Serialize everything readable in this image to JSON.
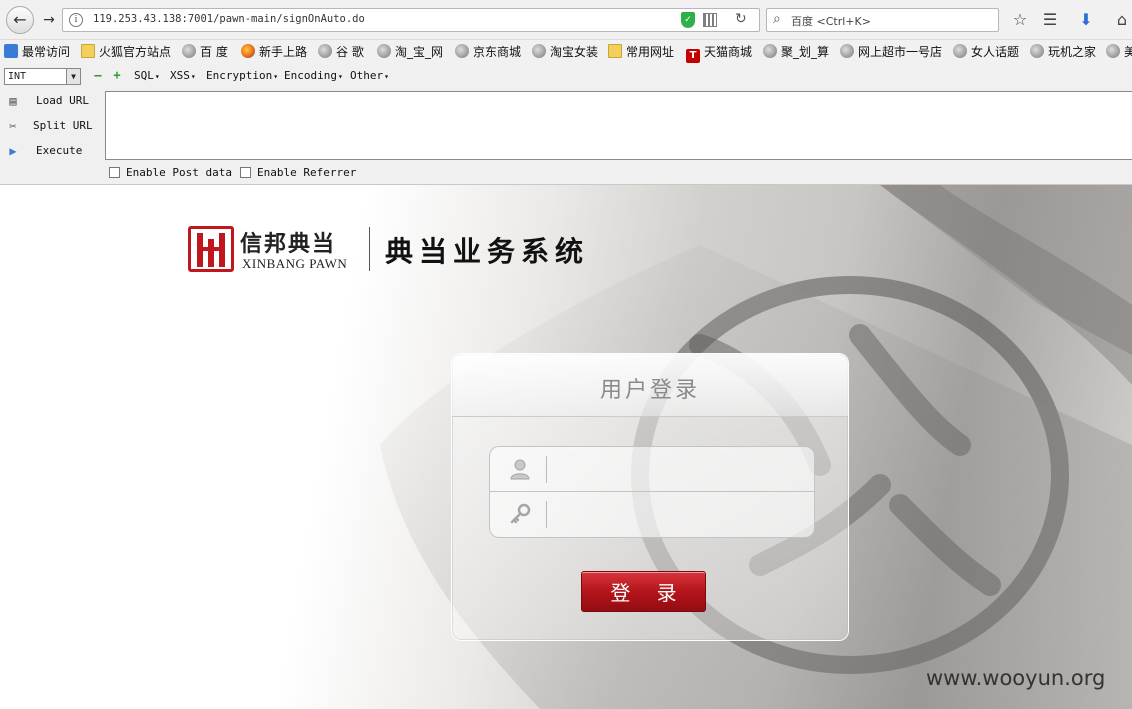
{
  "browser": {
    "back_icon": "back-arrow-icon",
    "url": "119.253.43.138:7001/pawn-main/signOnAuto.do",
    "search_placeholder": "百度 <Ctrl+K>",
    "info_icon": "i"
  },
  "bookmarks": [
    {
      "label": "最常访问",
      "icon": "blue"
    },
    {
      "label": "火狐官方站点",
      "icon": "folder"
    },
    {
      "label": "百 度",
      "icon": "globe"
    },
    {
      "label": "新手上路",
      "icon": "fox"
    },
    {
      "label": "谷 歌",
      "icon": "globe"
    },
    {
      "label": "淘_宝_网",
      "icon": "globe"
    },
    {
      "label": "京东商城",
      "icon": "globe"
    },
    {
      "label": "淘宝女装",
      "icon": "globe"
    },
    {
      "label": "常用网址",
      "icon": "folder"
    },
    {
      "label": "天猫商城",
      "icon": "tmall"
    },
    {
      "label": "聚_划_算",
      "icon": "globe"
    },
    {
      "label": "网上超市一号店",
      "icon": "globe"
    },
    {
      "label": "女人话题",
      "icon": "globe"
    },
    {
      "label": "玩机之家",
      "icon": "globe"
    },
    {
      "label": "美",
      "icon": "globe"
    }
  ],
  "hackbar": {
    "select_value": "INT",
    "menus": [
      "SQL",
      "XSS",
      "Encryption",
      "Encoding",
      "Other"
    ],
    "actions": [
      "Load URL",
      "Split URL",
      "Execute"
    ],
    "checkboxes": [
      "Enable Post data",
      "Enable Referrer"
    ]
  },
  "page": {
    "brand_cn": "信邦典当",
    "brand_en": "XINBANG PAWN",
    "system_title": "典当业务系统",
    "login_title": "用户登录",
    "username_value": "",
    "password_value": "",
    "login_button": "登 录",
    "watermark": "www.wooyun.org"
  },
  "colors": {
    "brand_red": "#c0171e",
    "button_red": "#b3151b"
  }
}
